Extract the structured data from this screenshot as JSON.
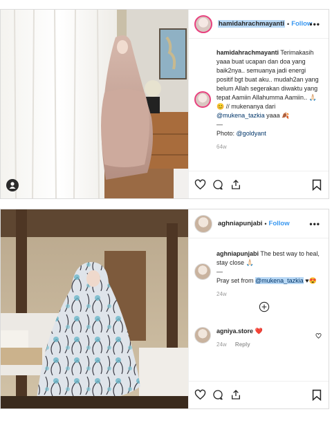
{
  "post1": {
    "username": "hamidahrachmayanti",
    "follow_label": "Follow",
    "more_label": "•••",
    "caption_username": "hamidahrachmayanti",
    "caption_text": "Terimakasih yaaa buat ucapan dan doa yang baik2nya.. semuanya jadi energi positif bgt buat aku.. mudah2an yang belum Allah segerakan diwaktu yang tepat Aamiin Allahumma Aamiin.. 🙏🏻😊 // mukenanya dari",
    "caption_mention": "@mukena_tazkia",
    "caption_tail": " yaaa 🍂",
    "divider": "—",
    "photo_credit_label": "Photo:",
    "photo_credit_mention": "@goldyant",
    "time": "64w"
  },
  "post2": {
    "username": "aghniapunjabi",
    "follow_label": "Follow",
    "more_label": "•••",
    "caption_username": "aghniapunjabi",
    "caption_text": "The best way to heal, stay close 🙏🏻",
    "divider": "—",
    "pray_prefix": "Pray set from ",
    "pray_mention": "@mukena_tazkia",
    "pray_tail": " ♥😍",
    "time": "24w",
    "comment_username": "agniya.store",
    "comment_text": "❤️",
    "comment_time": "24w",
    "reply_label": "Reply"
  },
  "colors": {
    "follow": "#3897f0",
    "story_ring": "#e8417f",
    "highlight": "#b8d8f5",
    "like_red": "#ed4956"
  },
  "icons": [
    "heart-icon",
    "comment-icon",
    "share-icon",
    "bookmark-icon",
    "more-icon",
    "plus-circle-icon",
    "user-tag-icon"
  ]
}
